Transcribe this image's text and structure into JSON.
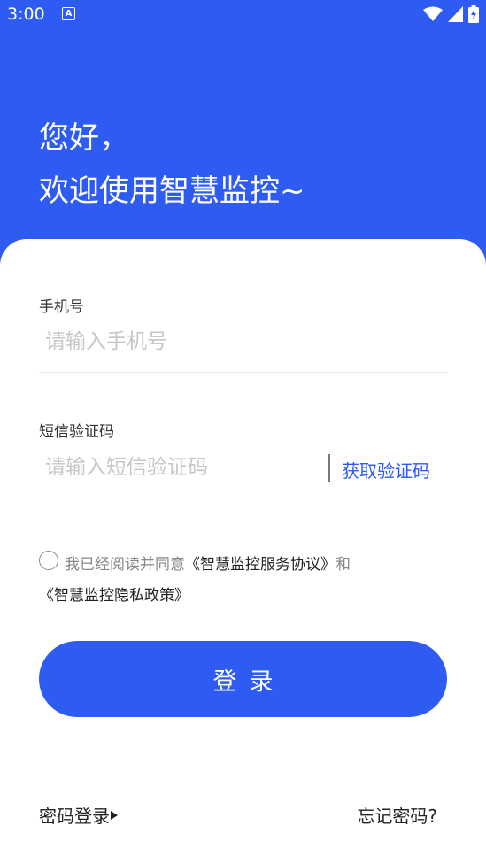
{
  "status": {
    "time": "3:00",
    "notify_glyph": "A"
  },
  "header": {
    "greeting_line1": "您好，",
    "greeting_line2": "欢迎使用智慧监控~"
  },
  "phone": {
    "label": "手机号",
    "placeholder": "请输入手机号",
    "value": ""
  },
  "sms": {
    "label": "短信验证码",
    "placeholder": "请输入短信验证码",
    "value": "",
    "get_code_label": "获取验证码"
  },
  "agreement": {
    "prefix": "我已经阅读并同意",
    "service_link": "《智慧监控服务协议》",
    "and": "和",
    "privacy_link": "《智慧监控隐私政策》",
    "checked": false
  },
  "login_button": "登录",
  "footer": {
    "password_login": "密码登录",
    "forgot_password": "忘记密码?"
  },
  "colors": {
    "primary": "#2e5bf2",
    "text": "#222222",
    "muted": "#888888",
    "placeholder": "#c6c6c6"
  },
  "icons": [
    "wifi-icon",
    "cell-signal-icon",
    "battery-charging-icon",
    "notification-a-icon",
    "radio-unchecked-icon",
    "play-arrow-icon"
  ]
}
